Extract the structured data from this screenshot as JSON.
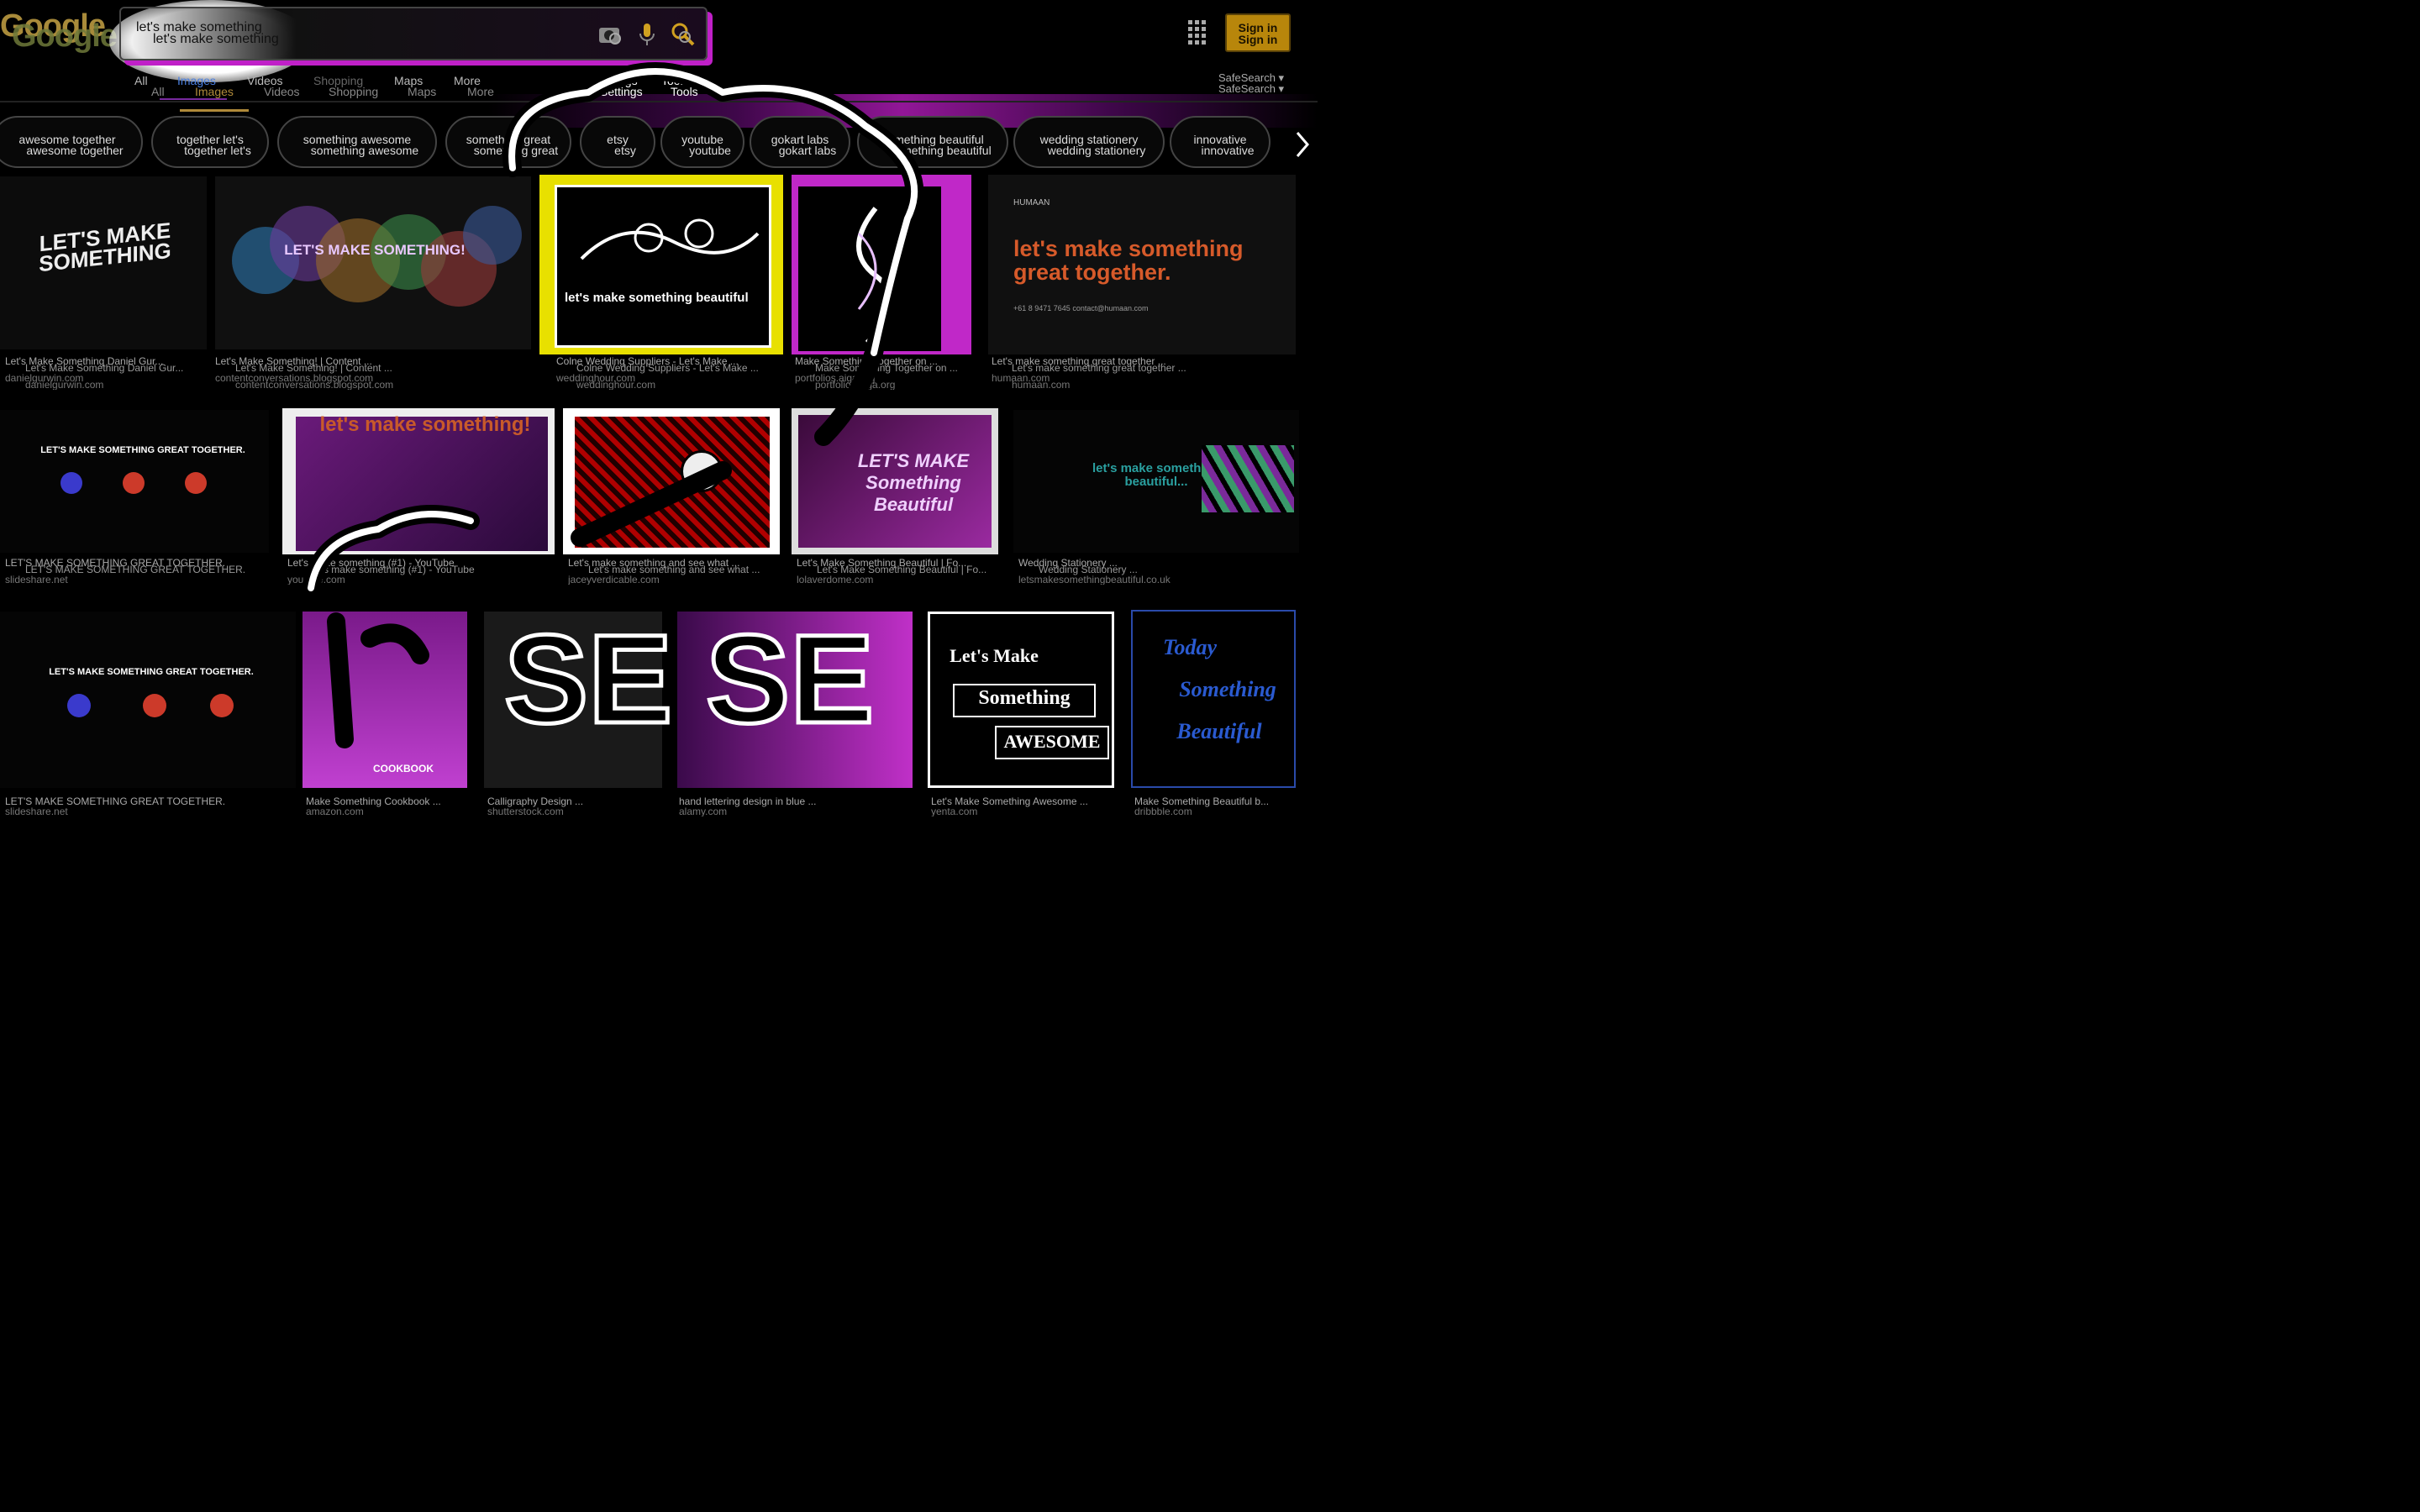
{
  "logo": {
    "text": "Google"
  },
  "search": {
    "query_line1": "let's make something",
    "query_line2": "let's make something"
  },
  "header": {
    "signin_label_1": "Sign in",
    "signin_label_2": "Sign in"
  },
  "tabs": [
    {
      "label": "All"
    },
    {
      "label": "Images"
    },
    {
      "label": "Videos"
    },
    {
      "label": "Shopping"
    },
    {
      "label": "Maps"
    },
    {
      "label": "More"
    },
    {
      "label": "Settings"
    },
    {
      "label": "Tools"
    }
  ],
  "tabs_dup": [
    {
      "label": "All"
    },
    {
      "label": "Images"
    },
    {
      "label": "Videos"
    },
    {
      "label": "Shopping"
    },
    {
      "label": "Maps"
    },
    {
      "label": "More"
    },
    {
      "label": "Settings"
    },
    {
      "label": "Tools"
    }
  ],
  "safesearch": {
    "label_1": "SafeSearch ▾",
    "label_2": "SafeSearch ▾"
  },
  "chips": [
    {
      "a": "awesome together",
      "b": "awesome together"
    },
    {
      "a": "together let's",
      "b": "together let's"
    },
    {
      "a": "something awesome",
      "b": "something awesome"
    },
    {
      "a": "something great",
      "b": "something great"
    },
    {
      "a": "etsy",
      "b": "etsy"
    },
    {
      "a": "youtube",
      "b": "youtube"
    },
    {
      "a": "gokart labs",
      "b": "gokart labs"
    },
    {
      "a": "something beautiful",
      "b": "something beautiful"
    },
    {
      "a": "wedding stationery",
      "b": "wedding stationery"
    },
    {
      "a": "innovative",
      "b": "innovative"
    }
  ],
  "results": [
    {
      "title": "Let's Make Something Daniel Gur...",
      "title2": "Let's Make Something Daniel Gur...",
      "source": "danielgurwin.com",
      "source2": "danielgurwin.com",
      "thumb": "LET'S MAKE SOMETHING"
    },
    {
      "title": "Let's Make Something! | Content ...",
      "title2": "Let's Make Something! | Content ...",
      "source": "contentconversations.blogspot.com",
      "source2": "contentconversations.blogspot.com",
      "thumb": "LET'S MAKE SOMETHING!"
    },
    {
      "title": "Colne Wedding Suppliers - Let's Make ...",
      "title2": "Colne Wedding Suppliers - Let's Make ...",
      "source": "weddinghour.com",
      "source2": "weddinghour.com",
      "thumb": "let's make something beautiful"
    },
    {
      "title": "Make Something Together on ...",
      "title2": "Make Something Together on ...",
      "source": "portfolios.aiga.org",
      "source2": "portfolios.aiga.org",
      "thumb": ""
    },
    {
      "title": "Let's make something great together ...",
      "title2": "Let's make something great together ...",
      "source": "humaan.com",
      "source2": "humaan.com",
      "thumb": "let's make something great together.",
      "brand": "HUMAAN",
      "contact": "+61 8 9471 7645     contact@humaan.com"
    },
    {
      "title": "LET'S MAKE SOMETHING GREAT TOGETHER.",
      "title2": "LET'S MAKE SOMETHING GREAT TOGETHER.",
      "source": "slideshare.net",
      "source2": "slideshare.net",
      "thumb": "LET'S MAKE SOMETHING GREAT TOGETHER."
    },
    {
      "title": "Let's make something (#1) - YouTube",
      "title2": "Let's make something (#1) - YouTube",
      "source": "youtube.com",
      "source2": "youtube.com",
      "thumb": "let's make something!"
    },
    {
      "title": "Let's make something and see what ...",
      "title2": "Let's make something and see what ...",
      "source": "jaceyverdicable.com",
      "source2": "jaceyverdicable.com",
      "thumb": ""
    },
    {
      "title": "Let's Make Something Beautiful | Fo...",
      "title2": "Let's Make Something Beautiful | Fo...",
      "source": "lolaverdome.com",
      "source2": "lolaverdome.com",
      "thumb": "LET'S MAKE Something Beautiful"
    },
    {
      "title": "Wedding Stationery ...",
      "title2": "Wedding Stationery ...",
      "source": "letsmakesomethingbeautiful.co.uk",
      "source2": "letsmakesomethingbeautiful.co.uk",
      "thumb": "let's make something beautiful..."
    },
    {
      "title": "LET'S MAKE SOMETHING GREAT TOGETHER.",
      "title2": "LET'S MAKE SOMETHING GREAT TOGETHER.",
      "source": "slideshare.net",
      "source2": "slideshare.net",
      "thumb": "LET'S MAKE SOMETHING GREAT TOGETHER."
    },
    {
      "title": "Make Something Cookbook ...",
      "title2": "Make Something Cookbook ...",
      "source": "amazon.com",
      "source2": "amazon.com",
      "thumb": "COOKBOOK"
    },
    {
      "title": "Calligraphy Design ...",
      "title2": "Calligraphy Design ...",
      "source": "shutterstock.com",
      "source2": "shutterstock.com",
      "thumb": ""
    },
    {
      "title": "hand lettering design in blue ...",
      "title2": "hand lettering design in blue ...",
      "source": "alamy.com",
      "source2": "alamy.com",
      "thumb": ""
    },
    {
      "title": "Let's Make Something Awesome ...",
      "title2": "Let's Make Something Awesome ...",
      "source": "yenta.com",
      "source2": "yenta.com",
      "thumb1": "Let's Make",
      "thumb2": "Something",
      "thumb3": "AWESOME"
    },
    {
      "title": "Make Something Beautiful b...",
      "title2": "Make Something Beautiful b...",
      "source": "dribbble.com",
      "source2": "dribbble.com",
      "thumb1": "Today",
      "thumb2": "Something",
      "thumb3": "Beautiful"
    }
  ],
  "colors": {
    "accent_magenta": "#c020c8",
    "tab_active": "#4a7fe0",
    "signin_bg": "#b8860b"
  }
}
